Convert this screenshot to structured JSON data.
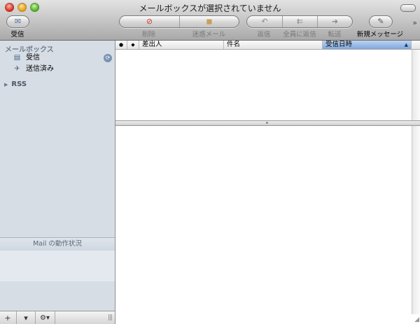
{
  "window": {
    "title": "メールボックスが選択されていません"
  },
  "toolbar": {
    "get_mail": "受信",
    "delete": "削除",
    "junk": "迷惑メール",
    "reply": "返信",
    "reply_all": "全員に返信",
    "forward": "転送",
    "new_message": "新規メッセージ",
    "overflow": "»"
  },
  "sidebar": {
    "header": "メールボックス",
    "items": [
      {
        "label": "受信",
        "icon": "inbox-icon"
      },
      {
        "label": "送信済み",
        "icon": "sent-icon"
      }
    ],
    "rss": "RSS",
    "activity_title": "Mail の動作状況",
    "bottom": {
      "add": "+",
      "mailbox_menu": "▾",
      "action": "⚙▾"
    }
  },
  "list": {
    "columns": [
      {
        "label": "●"
      },
      {
        "label": "💬"
      },
      {
        "label": "差出人"
      },
      {
        "label": "件名"
      },
      {
        "label": "受信日時",
        "sorted": true,
        "sort_arrow": "▲"
      }
    ]
  },
  "colors": {
    "sidebar_bg": "#d6dde5",
    "sorted_column": "#7fa7db",
    "badge": "#7b93b2"
  }
}
